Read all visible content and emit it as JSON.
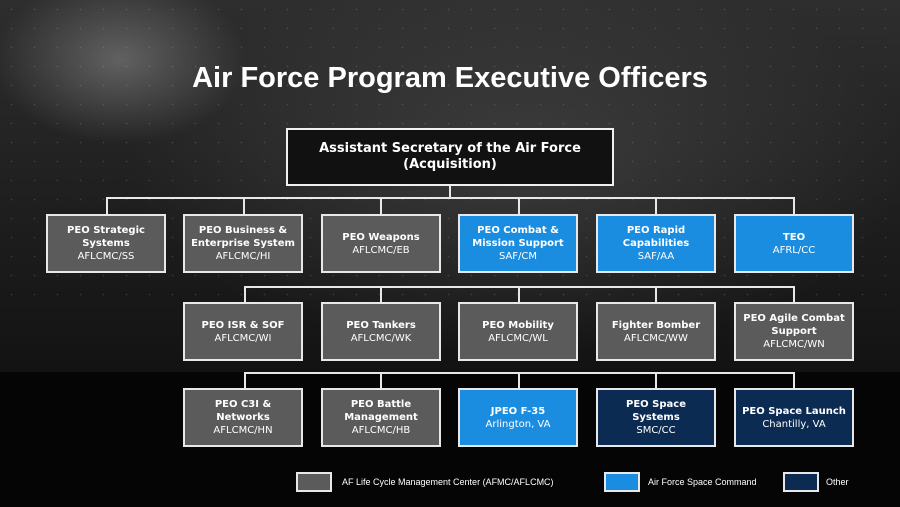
{
  "title": "Air Force Program Executive Officers",
  "top": {
    "name": "Assistant Secretary of the Air Force (Acquisition)"
  },
  "row1": [
    {
      "name": "PEO Strategic Systems",
      "code": "AFLCMC/SS",
      "color": "gray"
    },
    {
      "name": "PEO Business & Enterprise System",
      "code": "AFLCMC/HI",
      "color": "gray"
    },
    {
      "name": "PEO Weapons",
      "code": "AFLCMC/EB",
      "color": "gray"
    },
    {
      "name": "PEO Combat & Mission Support",
      "code": "SAF/CM",
      "color": "blue"
    },
    {
      "name": "PEO Rapid Capabilities",
      "code": "SAF/AA",
      "color": "blue"
    },
    {
      "name": "TEO",
      "code": "AFRL/CC",
      "color": "blue"
    }
  ],
  "row2": [
    {
      "name": "PEO ISR & SOF",
      "code": "AFLCMC/WI",
      "color": "gray"
    },
    {
      "name": "PEO Tankers",
      "code": "AFLCMC/WK",
      "color": "gray"
    },
    {
      "name": "PEO Mobility",
      "code": "AFLCMC/WL",
      "color": "gray"
    },
    {
      "name": "Fighter Bomber",
      "code": "AFLCMC/WW",
      "color": "gray"
    },
    {
      "name": "PEO Agile Combat Support",
      "code": "AFLCMC/WN",
      "color": "gray"
    }
  ],
  "row3": [
    {
      "name": "PEO C3I & Networks",
      "code": "AFLCMC/HN",
      "color": "gray"
    },
    {
      "name": "PEO Battle Management",
      "code": "AFLCMC/HB",
      "color": "gray"
    },
    {
      "name": "JPEO F-35",
      "code": "Arlington, VA",
      "color": "blue"
    },
    {
      "name": "PEO Space Systems",
      "code": "SMC/CC",
      "color": "navy"
    },
    {
      "name": "PEO Space Launch",
      "code": "Chantilly, VA",
      "color": "navy"
    }
  ],
  "legend": [
    {
      "label": "AF Life Cycle Management Center (AFMC/AFLCMC)",
      "color": "#5b5b5b"
    },
    {
      "label": "Air Force Space Command",
      "color": "#1b8de0"
    },
    {
      "label": "Other",
      "color": "#0c2b52"
    }
  ]
}
